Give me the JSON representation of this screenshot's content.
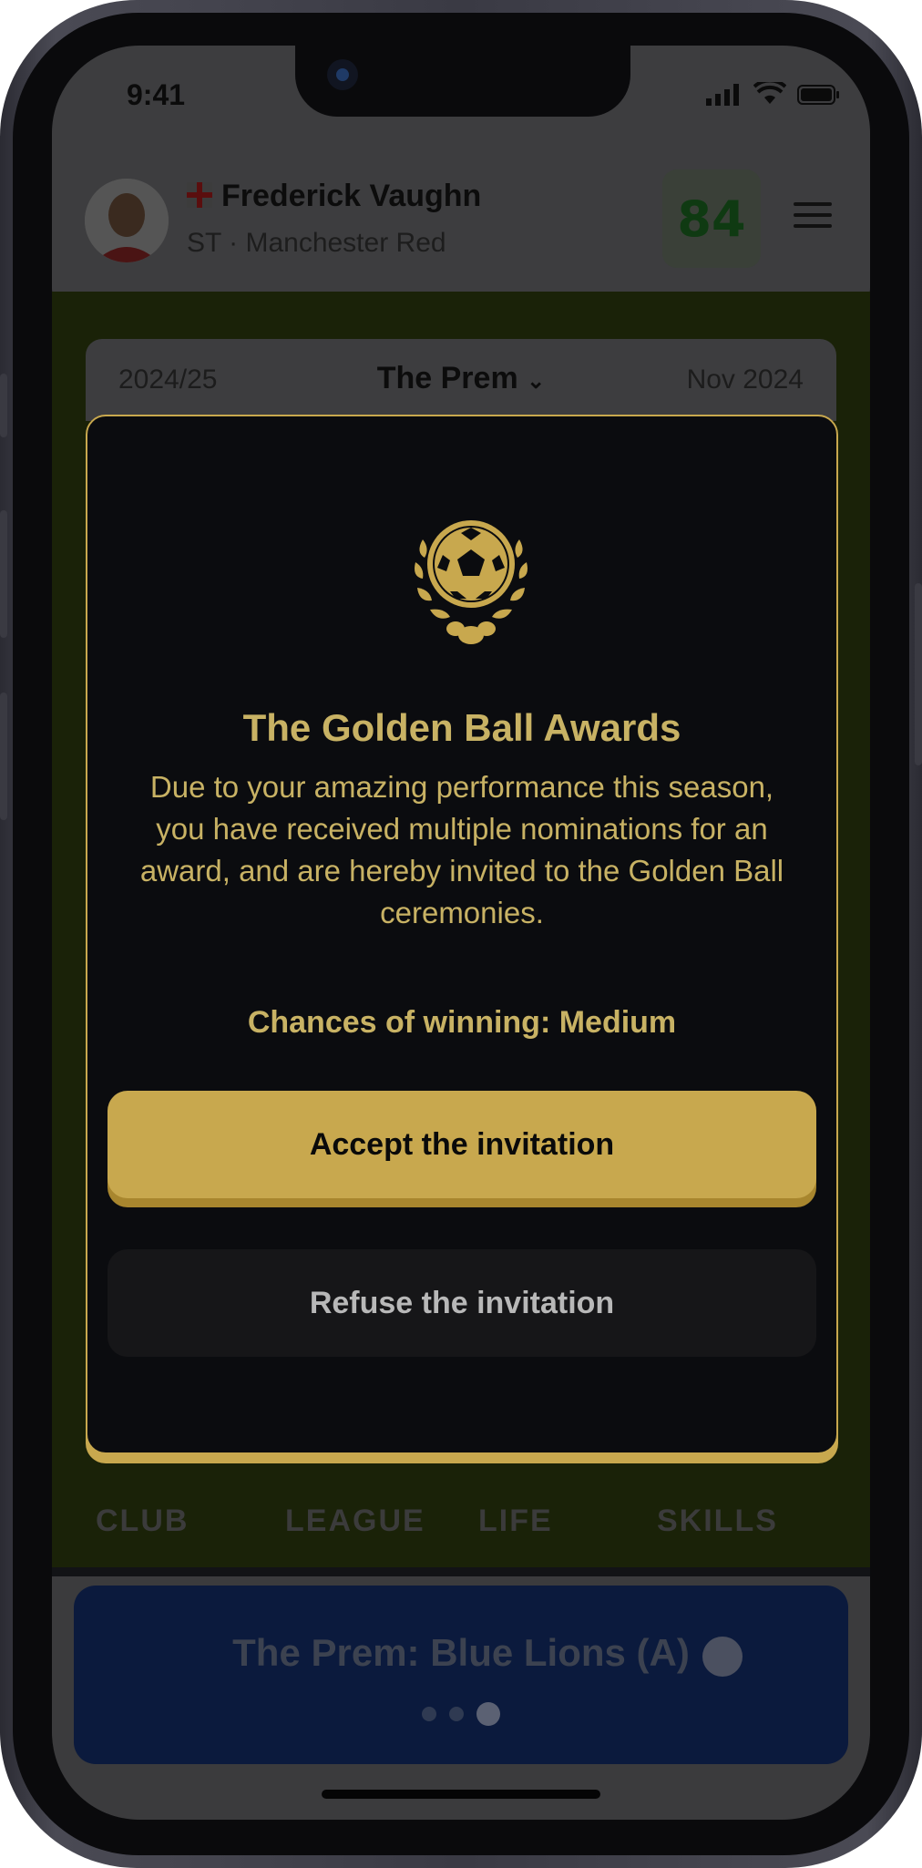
{
  "status": {
    "time": "9:41"
  },
  "player": {
    "name": "Frederick Vaughn",
    "subtitle": "ST · Manchester Red",
    "rating": "84"
  },
  "season": {
    "year": "2024/25",
    "league": "The Prem",
    "month": "Nov 2024"
  },
  "nav": {
    "club": "CLUB",
    "league": "LEAGUE",
    "life": "LIFE",
    "skills": "SKILLS"
  },
  "fixture": {
    "label": "The Prem: Blue Lions (A)"
  },
  "modal": {
    "title": "The Golden Ball Awards",
    "body": "Due to your amazing performance this season, you have received multiple nominations for an award, and are hereby invited to the Golden Ball ceremonies.",
    "chance": "Chances of winning: Medium",
    "accept_label": "Accept the invitation",
    "refuse_label": "Refuse the invitation"
  },
  "colors": {
    "gold": "#c8a84e",
    "gold_text": "#c8b264",
    "modal_bg": "#0b0c0f"
  }
}
